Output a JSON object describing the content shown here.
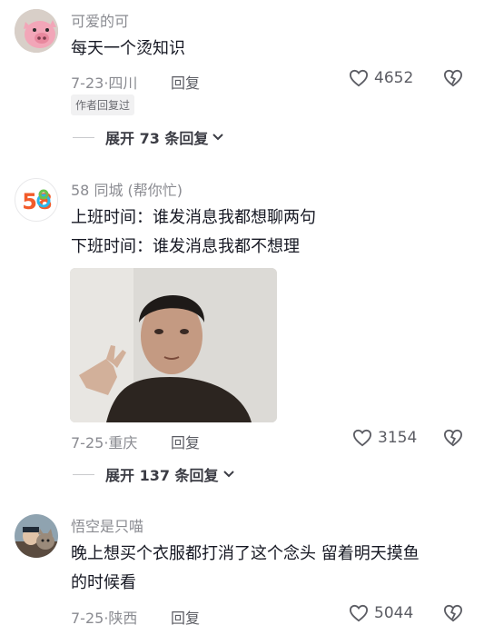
{
  "comments": [
    {
      "username": "可爱的可",
      "lines": [
        "每天一个烫知识"
      ],
      "date": "7-23",
      "location": "四川",
      "reply_label": "回复",
      "likes": "4652",
      "badge": "作者回复过",
      "expand_label": "展开 73 条回复"
    },
    {
      "username": "58 同城 (帮你忙)",
      "lines": [
        "上班时间：谁发消息我都想聊两句",
        "下班时间：谁发消息我都不想理"
      ],
      "date": "7-25",
      "location": "重庆",
      "reply_label": "回复",
      "likes": "3154",
      "expand_label": "展开 137 条回复"
    },
    {
      "username": "悟空是只喵",
      "lines": [
        "晚上想买个衣服都打消了这个念头 留着明天摸鱼",
        "的时候看"
      ],
      "date": "7-25",
      "location": "陕西",
      "reply_label": "回复",
      "likes": "5044"
    }
  ],
  "logo_58": "58"
}
